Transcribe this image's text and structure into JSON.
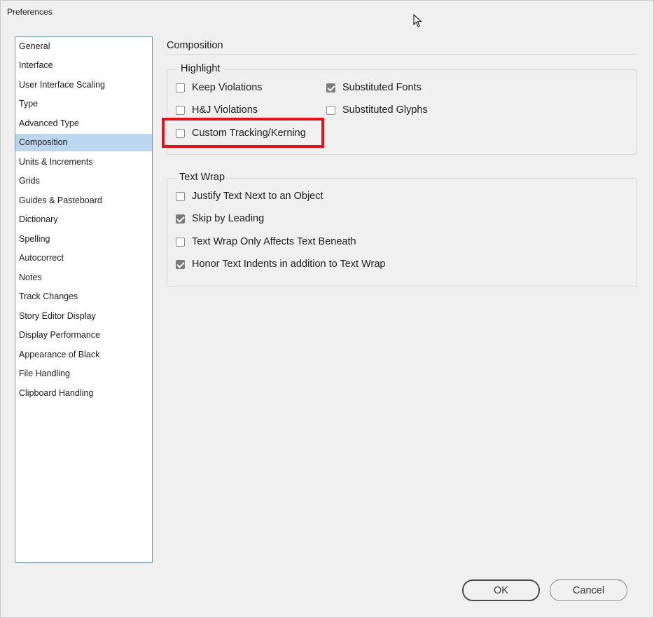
{
  "window": {
    "title": "Preferences"
  },
  "sidebar": {
    "items": [
      {
        "label": "General"
      },
      {
        "label": "Interface"
      },
      {
        "label": "User Interface Scaling"
      },
      {
        "label": "Type"
      },
      {
        "label": "Advanced Type"
      },
      {
        "label": "Composition",
        "selected": true
      },
      {
        "label": "Units & Increments"
      },
      {
        "label": "Grids"
      },
      {
        "label": "Guides & Pasteboard"
      },
      {
        "label": "Dictionary"
      },
      {
        "label": "Spelling"
      },
      {
        "label": "Autocorrect"
      },
      {
        "label": "Notes"
      },
      {
        "label": "Track Changes"
      },
      {
        "label": "Story Editor Display"
      },
      {
        "label": "Display Performance"
      },
      {
        "label": "Appearance of Black"
      },
      {
        "label": "File Handling"
      },
      {
        "label": "Clipboard Handling"
      }
    ]
  },
  "main": {
    "section_title": "Composition",
    "highlight": {
      "label": "Highlight",
      "options": {
        "keep_violations": {
          "label": "Keep Violations",
          "checked": false
        },
        "hj_violations": {
          "label": "H&J Violations",
          "checked": false
        },
        "custom_tracking": {
          "label": "Custom Tracking/Kerning",
          "checked": false
        },
        "substituted_fonts": {
          "label": "Substituted Fonts",
          "checked": true
        },
        "substituted_glyphs": {
          "label": "Substituted Glyphs",
          "checked": false
        }
      }
    },
    "text_wrap": {
      "label": "Text Wrap",
      "options": {
        "justify": {
          "label": "Justify Text Next to an Object",
          "checked": false
        },
        "skip_leading": {
          "label": "Skip by Leading",
          "checked": true
        },
        "only_beneath": {
          "label": "Text Wrap Only Affects Text Beneath",
          "checked": false
        },
        "honor_indents": {
          "label": "Honor Text Indents in addition to Text Wrap",
          "checked": true
        }
      }
    }
  },
  "buttons": {
    "ok": "OK",
    "cancel": "Cancel"
  },
  "colors": {
    "accent_highlight": "#e0151b",
    "selected_row": "#bcd5f0"
  }
}
